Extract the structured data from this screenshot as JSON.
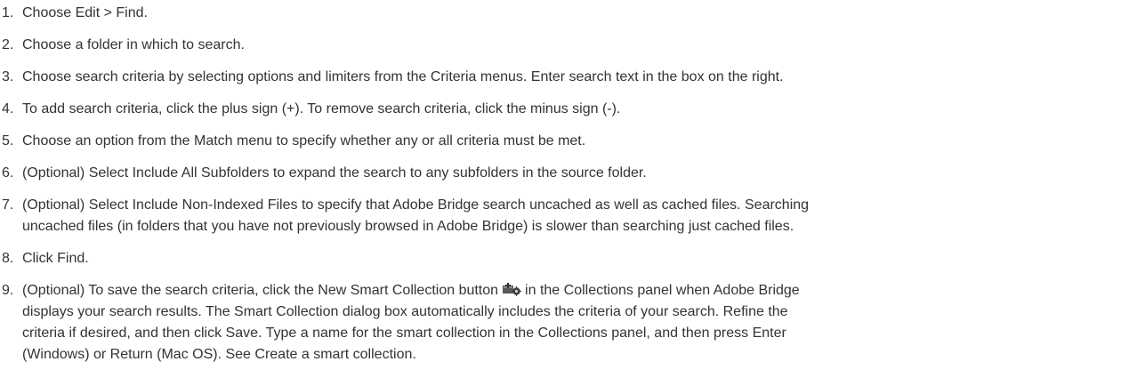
{
  "steps": [
    {
      "num": "1.",
      "text": "Choose Edit > Find."
    },
    {
      "num": "2.",
      "text": "Choose a folder in which to search."
    },
    {
      "num": "3.",
      "text": "Choose search criteria by selecting options and limiters from the Criteria menus. Enter search text in the box on the right."
    },
    {
      "num": "4.",
      "text": "To add search criteria, click the plus sign (+). To remove search criteria, click the minus sign (-)."
    },
    {
      "num": "5.",
      "text": "Choose an option from the Match menu to specify whether any or all criteria must be met."
    },
    {
      "num": "6.",
      "text": "(Optional) Select Include All Subfolders to expand the search to any subfolders in the source folder."
    },
    {
      "num": "7.",
      "line1": "(Optional) Select Include Non-Indexed Files to specify that Adobe Bridge search uncached as well as cached files. Searching",
      "line2": "uncached files (in folders that you have not previously browsed in Adobe Bridge) is slower than searching just cached files."
    },
    {
      "num": "8.",
      "text": "Click Find."
    },
    {
      "num": "9.",
      "line1_before_icon": "(Optional) To save the search criteria, click the New Smart Collection button",
      "line1_after_icon": "in the Collections panel when Adobe Bridge",
      "line2": "displays your search results. The Smart Collection dialog box automatically includes the criteria of your search. Refine the",
      "line3": "criteria if desired, and then click Save. Type a name for the smart collection in the Collections panel, and then press Enter",
      "line4": "(Windows) or Return (Mac OS). See Create a smart collection.",
      "icon": "new-smart-collection-icon"
    }
  ]
}
